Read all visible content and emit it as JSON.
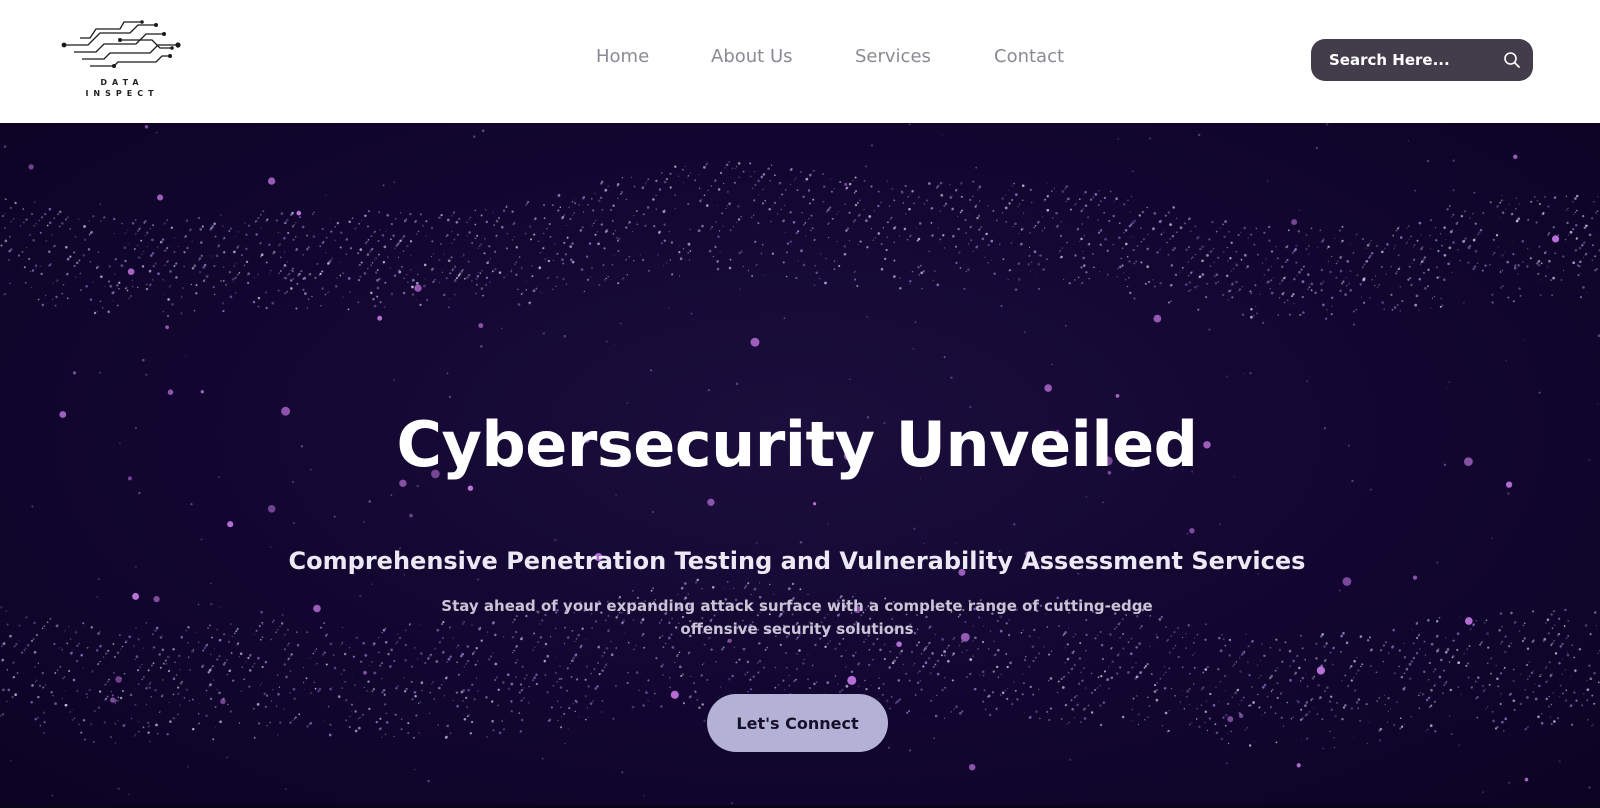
{
  "logo": {
    "line1": "DATA",
    "line2": "INSPECT",
    "icon": "circuit-icon"
  },
  "nav": {
    "items": [
      {
        "label": "Home"
      },
      {
        "label": "About Us"
      },
      {
        "label": "Services"
      },
      {
        "label": "Contact"
      }
    ]
  },
  "search": {
    "placeholder": "Search Here...",
    "icon": "search-icon"
  },
  "hero": {
    "title": "Cybersecurity Unveiled",
    "subtitle": "Comprehensive Penetration Testing and Vulnerability Assessment Services",
    "description": "Stay ahead of your expanding attack surface with a complete range of cutting-edge offensive security solutions",
    "cta_label": "Let's Connect"
  },
  "colors": {
    "hero_background": "#120630",
    "particle": "#c97be8",
    "button": "#b3b2d6",
    "search_background": "#433d4b",
    "nav_text": "#8a8a93"
  }
}
